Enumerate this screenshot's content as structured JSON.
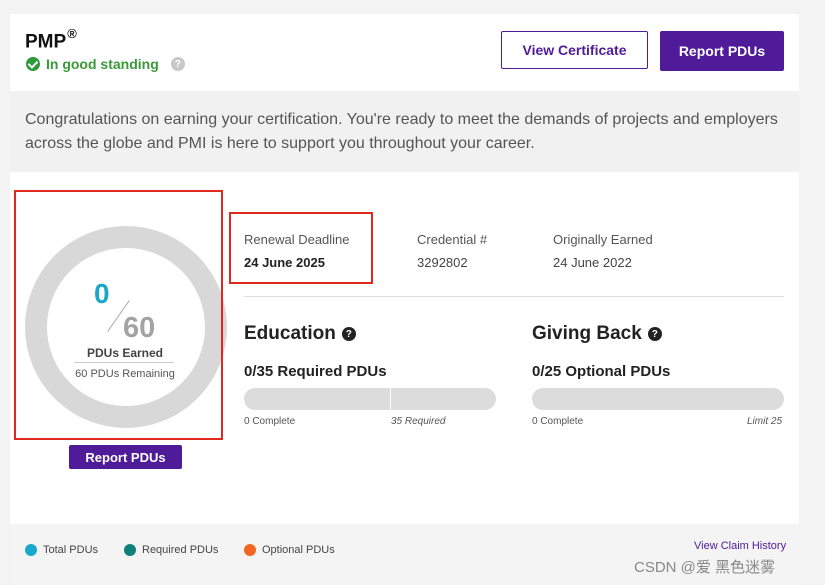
{
  "header": {
    "title": "PMP",
    "registered_mark": "®",
    "standing": "In good standing",
    "view_certificate": "View Certificate",
    "report_pdus": "Report PDUs"
  },
  "congrats": "Congratulations on earning your certification. You're ready to meet the demands of projects and employers across the globe and PMI is here to support you throughout your career.",
  "donut": {
    "earned": "0",
    "total": "60",
    "label": "PDUs Earned",
    "remaining": "60 PDUs Remaining",
    "button": "Report PDUs"
  },
  "info": {
    "renewal_label": "Renewal Deadline",
    "renewal_value": "24 June 2025",
    "credential_label": "Credential #",
    "credential_value": "3292802",
    "earned_label": "Originally Earned",
    "earned_value": "24 June 2022"
  },
  "education": {
    "title": "Education",
    "subtitle": "0/35 Required PDUs",
    "complete": "0 Complete",
    "required": "35 Required",
    "progress": 0
  },
  "giving_back": {
    "title": "Giving Back",
    "subtitle": "0/25 Optional PDUs",
    "complete": "0 Complete",
    "limit": "Limit 25",
    "progress": 0
  },
  "legend": {
    "total": "Total PDUs",
    "required": "Required PDUs",
    "optional": "Optional PDUs",
    "colors": {
      "total": "#1aa7c9",
      "required": "#0f7f7a",
      "optional": "#f26522"
    }
  },
  "claim_history": "View Claim History",
  "watermark": "CSDN @爱 黑色迷雾",
  "colors": {
    "brand": "#4f1b99",
    "success": "#2e9a3a",
    "highlight": "#e0281c"
  }
}
